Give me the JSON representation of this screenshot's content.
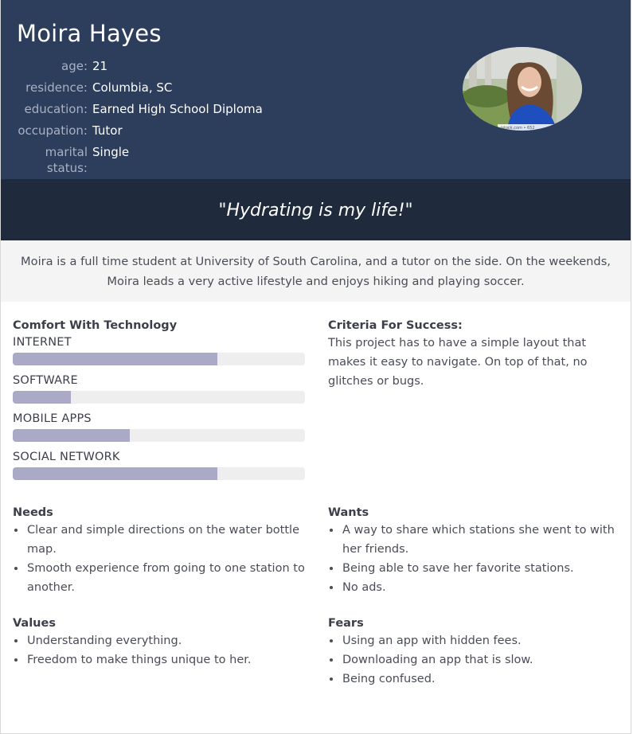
{
  "persona": {
    "name": "Moira Hayes",
    "facts": [
      {
        "label": "age:",
        "value": "21"
      },
      {
        "label": "residence:",
        "value": "Columbia, SC"
      },
      {
        "label": "education:",
        "value": "Earned High School Diploma"
      },
      {
        "label": "occupation:",
        "value": "Tutor"
      },
      {
        "label": "marital status:",
        "value": "Single"
      }
    ],
    "photo_watermark": "istock.com • 652"
  },
  "quote": "\"Hydrating is my life!\"",
  "bio": "Moira is a full time student at University of South Carolina, and a tutor on the side. On the weekends, Moira leads a very active lifestyle and enjoys hiking and playing soccer.",
  "tech": {
    "title": "Comfort With Technology",
    "items": [
      {
        "label": "INTERNET",
        "level": 0.7
      },
      {
        "label": "SOFTWARE",
        "level": 0.2
      },
      {
        "label": "MOBILE APPS",
        "level": 0.4
      },
      {
        "label": "SOCIAL NETWORK",
        "level": 0.7
      }
    ],
    "fill_color": "#abaac6",
    "track_color": "#eeeeee"
  },
  "criteria": {
    "title": "Criteria For Success:",
    "text": "This project has to have a simple layout that makes it easy to navigate. On top of that, no glitches or bugs."
  },
  "needs": {
    "title": "Needs",
    "items": [
      "Clear and simple directions on the water bottle map.",
      "Smooth experience from going to one station to another."
    ]
  },
  "wants": {
    "title": "Wants",
    "items": [
      "A way to share which stations she went to with her friends.",
      "Being able to save her favorite stations.",
      "No ads."
    ]
  },
  "values": {
    "title": "Values",
    "items": [
      "Understanding everything.",
      "Freedom to make things unique to her."
    ]
  },
  "fears": {
    "title": "Fears",
    "items": [
      "Using an app with hidden fees.",
      "Downloading an app that is slow.",
      "Being confused."
    ]
  },
  "colors": {
    "header_bg": "#2d3d5c",
    "quote_bg": "#1f2a3c",
    "bio_bg": "#f4f4f4"
  }
}
